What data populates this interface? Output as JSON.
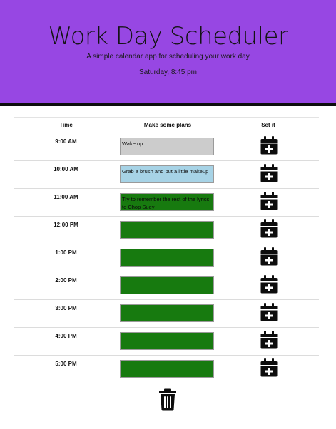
{
  "header": {
    "title": "Work Day Scheduler",
    "lead": "A simple calendar app for scheduling your work day",
    "current_day": "Saturday, 8:45 pm"
  },
  "table_headers": {
    "time": "Time",
    "plans": "Make some plans",
    "save": "Set it"
  },
  "rows": [
    {
      "time": "9:00 AM",
      "plan": "Wake up",
      "state": "past"
    },
    {
      "time": "10:00 AM",
      "plan": "Grab a brush and put a little makeup",
      "state": "present"
    },
    {
      "time": "11:00 AM",
      "plan": "Try to remember the rest of the lyrics to Chop Suey",
      "state": "future"
    },
    {
      "time": "12:00 PM",
      "plan": "",
      "state": "future"
    },
    {
      "time": "1:00 PM",
      "plan": "",
      "state": "future"
    },
    {
      "time": "2:00 PM",
      "plan": "",
      "state": "future"
    },
    {
      "time": "3:00 PM",
      "plan": "",
      "state": "future"
    },
    {
      "time": "4:00 PM",
      "plan": "",
      "state": "future"
    },
    {
      "time": "5:00 PM",
      "plan": "",
      "state": "future"
    }
  ],
  "icons": {
    "save": "calendar-plus-icon",
    "clear": "trash-icon"
  },
  "colors": {
    "header_bg": "#9747e3",
    "past": "#cccccc",
    "present": "#a7d3e6",
    "future": "#177a0f"
  }
}
